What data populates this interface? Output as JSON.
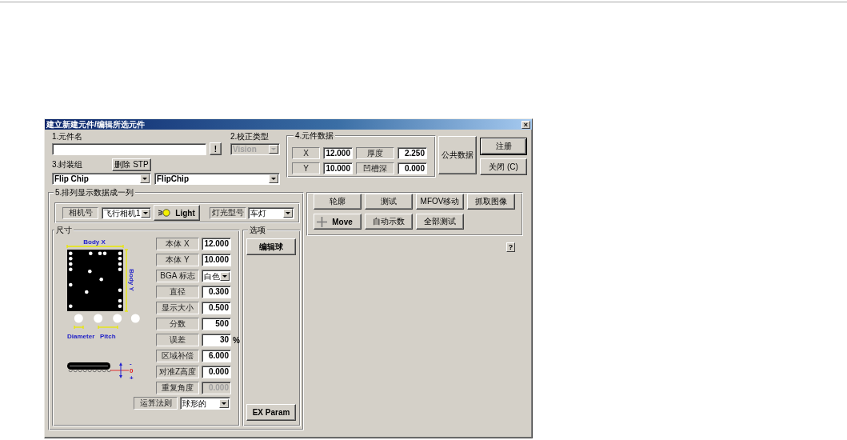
{
  "window": {
    "title": "建立新建元件/编辑所选元件",
    "close": "×"
  },
  "part_name": {
    "label": "1.元件名",
    "button": "!"
  },
  "calibration": {
    "label": "2.校正类型",
    "value": "Vision",
    "disabled": true
  },
  "package_group": {
    "label": "3.封装组",
    "delete_button": "删除 STP",
    "package": "Flip Chip",
    "package_type": "FlipChip"
  },
  "component_data": {
    "title": "4.元件数据",
    "fields": [
      {
        "label": "X",
        "value": "12.000"
      },
      {
        "label": "厚度",
        "value": "2.250"
      },
      {
        "label": "Y",
        "value": "10.000"
      },
      {
        "label": "凹槽深",
        "value": "0.000"
      }
    ]
  },
  "side_buttons": [
    {
      "label": "公共数据",
      "kind": "tall",
      "default": false
    },
    {
      "label": "注册",
      "kind": "small",
      "default": true
    },
    {
      "label": "关闭 (C)",
      "kind": "small",
      "default": false
    }
  ],
  "display": {
    "title": "5.排列显示数据成一列",
    "camera_label": "相机号",
    "camera": "飞行相机1",
    "light_button": "Light",
    "light_type_label": "灯光型号",
    "light_type": "车灯",
    "size": {
      "title": "尺寸",
      "diagram": {
        "body_x": "Body X",
        "body_y": "Body Y",
        "diameter": "Diameter",
        "pitch": "Pitch"
      },
      "side_view_marks": [
        "-",
        "0",
        "+"
      ],
      "params": [
        {
          "label": "本体 X",
          "kind": "input",
          "value": "12.000",
          "disabled": false
        },
        {
          "label": "本体 Y",
          "kind": "input",
          "value": "10.000",
          "disabled": false
        },
        {
          "label": "BGA 标志",
          "kind": "combo",
          "value": "白色",
          "disabled": false
        },
        {
          "label": "直径",
          "kind": "input",
          "value": "0.300",
          "disabled": false
        },
        {
          "label": "显示大小",
          "kind": "input",
          "value": "0.500",
          "disabled": false
        },
        {
          "label": "分数",
          "kind": "input",
          "value": "500",
          "disabled": false
        },
        {
          "label": "误差",
          "kind": "input",
          "value": "30",
          "unit": "%",
          "disabled": false
        },
        {
          "label": "区域补偿",
          "kind": "input",
          "value": "6.000",
          "disabled": false
        },
        {
          "label": "对准Z高度",
          "kind": "input",
          "value": "0.000",
          "disabled": false
        },
        {
          "label": "重复角度",
          "kind": "input",
          "value": "0.000",
          "disabled": true
        }
      ],
      "algorithm": {
        "label": "运算法则",
        "value": "球形的"
      }
    },
    "options": {
      "title": "选项",
      "buttons": [
        "编辑球",
        "EX Param"
      ]
    }
  },
  "tools": [
    {
      "label": "轮廓",
      "kind": "text"
    },
    {
      "label": "测试",
      "kind": "text"
    },
    {
      "label": "MFOV移动",
      "kind": "text"
    },
    {
      "label": "抓取图像",
      "kind": "text"
    },
    {
      "label": "Move",
      "kind": "move"
    },
    {
      "label": "自动示数",
      "kind": "text"
    },
    {
      "label": "全部测试",
      "kind": "text"
    }
  ],
  "help": "?"
}
